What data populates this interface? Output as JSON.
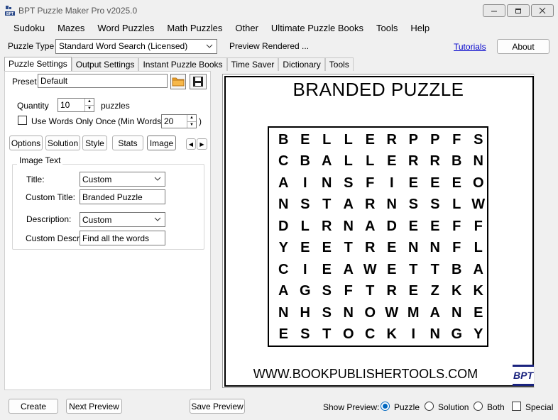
{
  "window": {
    "title": "BPT Puzzle Maker Pro v2025.0"
  },
  "menu": [
    "Sudoku",
    "Mazes",
    "Word Puzzles",
    "Math Puzzles",
    "Other",
    "Ultimate Puzzle Books",
    "Tools",
    "Help"
  ],
  "toolbar": {
    "puzzle_type_label": "Puzzle Type",
    "puzzle_type_value": "Standard Word Search (Licensed)",
    "preview_status": "Preview Rendered ...",
    "tutorials_link": "Tutorials",
    "about_label": "About"
  },
  "main_tabs": [
    "Puzzle Settings",
    "Output Settings",
    "Instant Puzzle Books",
    "Time Saver",
    "Dictionary",
    "Tools"
  ],
  "settings": {
    "preset_label": "Preset",
    "preset_value": "Default",
    "quantity_label": "Quantity",
    "quantity_value": "10",
    "quantity_suffix": "puzzles",
    "words_once_label": "Use Words Only Once",
    "min_words_label": "(Min Words:",
    "min_words_value": "20",
    "min_words_close": ")"
  },
  "sub_tabs": [
    "Options",
    "Solution",
    "Style",
    "Stats",
    "Image"
  ],
  "image_text": {
    "group_title": "Image Text",
    "title_label": "Title:",
    "title_value": "Custom",
    "custom_title_label": "Custom Title:",
    "custom_title_value": "Branded Puzzle",
    "description_label": "Description:",
    "description_value": "Custom",
    "custom_descr_label": "Custom Descr:",
    "custom_descr_value": "Find all the words"
  },
  "preview": {
    "title": "BRANDED PUZZLE",
    "grid": [
      "BELLERPPFS",
      "CBALLERRBN",
      "AINSFIEEEO",
      "NSTARNSSLW",
      "DLRNADEEFF",
      "YEETRENNFL",
      "CIEAWETTBA",
      "AGSFTREZKK",
      "NHSNOWMANE",
      "ESTOCKINGY"
    ],
    "footer_url": "WWW.BOOKPUBLISHERTOOLS.COM",
    "logo_text": "BPT"
  },
  "bottom": {
    "create_label": "Create",
    "next_preview_label": "Next Preview",
    "save_preview_label": "Save Preview",
    "show_preview_label": "Show Preview:",
    "radio_puzzle": "Puzzle",
    "radio_solution": "Solution",
    "radio_both": "Both",
    "special_label": "Special",
    "selected_preview": "Puzzle"
  },
  "colors": {
    "accent": "#0067c0",
    "folder_icon": "#f5a623",
    "logo": "#1a237e"
  }
}
